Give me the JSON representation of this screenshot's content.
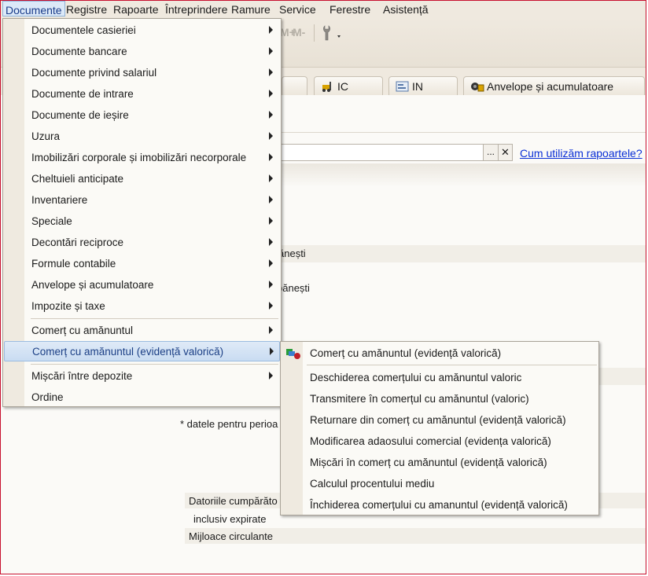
{
  "menubar": {
    "items": [
      "Documente",
      "Registre",
      "Rapoarte",
      "Întreprindere",
      "Ramure",
      "Service",
      "Ferestre",
      "Asistență"
    ]
  },
  "toolbar": {
    "mplus": "M+",
    "mminus": "M-"
  },
  "tabs": [
    {
      "label": "IC",
      "icon": "forklift-icon"
    },
    {
      "label": "IN",
      "icon": "inventory-icon"
    },
    {
      "label": "Anvelope și acumulatoare",
      "icon": "tire-icon"
    }
  ],
  "search": {
    "more": "...",
    "clear": "✕",
    "help_link": "Cum utilizăm rapoartele?"
  },
  "background": {
    "frag1": "ănești",
    "frag2": "bănești",
    "note": "* datele pentru perioa",
    "row1": "Datoriile cumpărăto",
    "row2": "inclusiv expirate",
    "row3": "Mijloace circulante"
  },
  "dropdown": {
    "items": [
      {
        "label": "Documentele casieriei",
        "submenu": true
      },
      {
        "label": "Documente bancare",
        "submenu": true
      },
      {
        "label": "Documente privind salariul",
        "submenu": true
      },
      {
        "label": "Documente de intrare",
        "submenu": true
      },
      {
        "label": "Documente de ieșire",
        "submenu": true
      },
      {
        "label": "Uzura",
        "submenu": true
      },
      {
        "label": "Imobilizări corporale și imobilizări necorporale",
        "submenu": true
      },
      {
        "label": "Cheltuieli anticipate",
        "submenu": true
      },
      {
        "label": "Inventariere",
        "submenu": true
      },
      {
        "label": "Speciale",
        "submenu": true
      },
      {
        "label": "Decontări reciproce",
        "submenu": true
      },
      {
        "label": "Formule contabile",
        "submenu": true
      },
      {
        "label": "Anvelope și acumulatoare",
        "submenu": true
      },
      {
        "label": "Impozite și taxe",
        "submenu": true
      },
      {
        "label": "Comerț cu amănuntul",
        "submenu": true
      },
      {
        "label": "Comerț cu amănuntul (evidență valorică)",
        "submenu": true,
        "highlighted": true
      },
      {
        "label": "Mișcări între depozite",
        "submenu": true
      },
      {
        "label": "Ordine",
        "submenu": false
      }
    ]
  },
  "submenu": {
    "items": [
      "Comerț cu amănuntul (evidență valorică)",
      "Deschiderea comerțului cu amănuntul valoric",
      "Transmitere în comerțul cu amănuntul (valoric)",
      "Returnare din comerț cu amănuntul (evidență valorică)",
      "Modificarea adaosului comercial (evidența valorică)",
      "Mișcări în comerț cu amănuntul (evidență valorică)",
      "Calculul procentului mediu",
      "Închiderea comerțului cu amanuntul (evidență valorică)"
    ]
  }
}
